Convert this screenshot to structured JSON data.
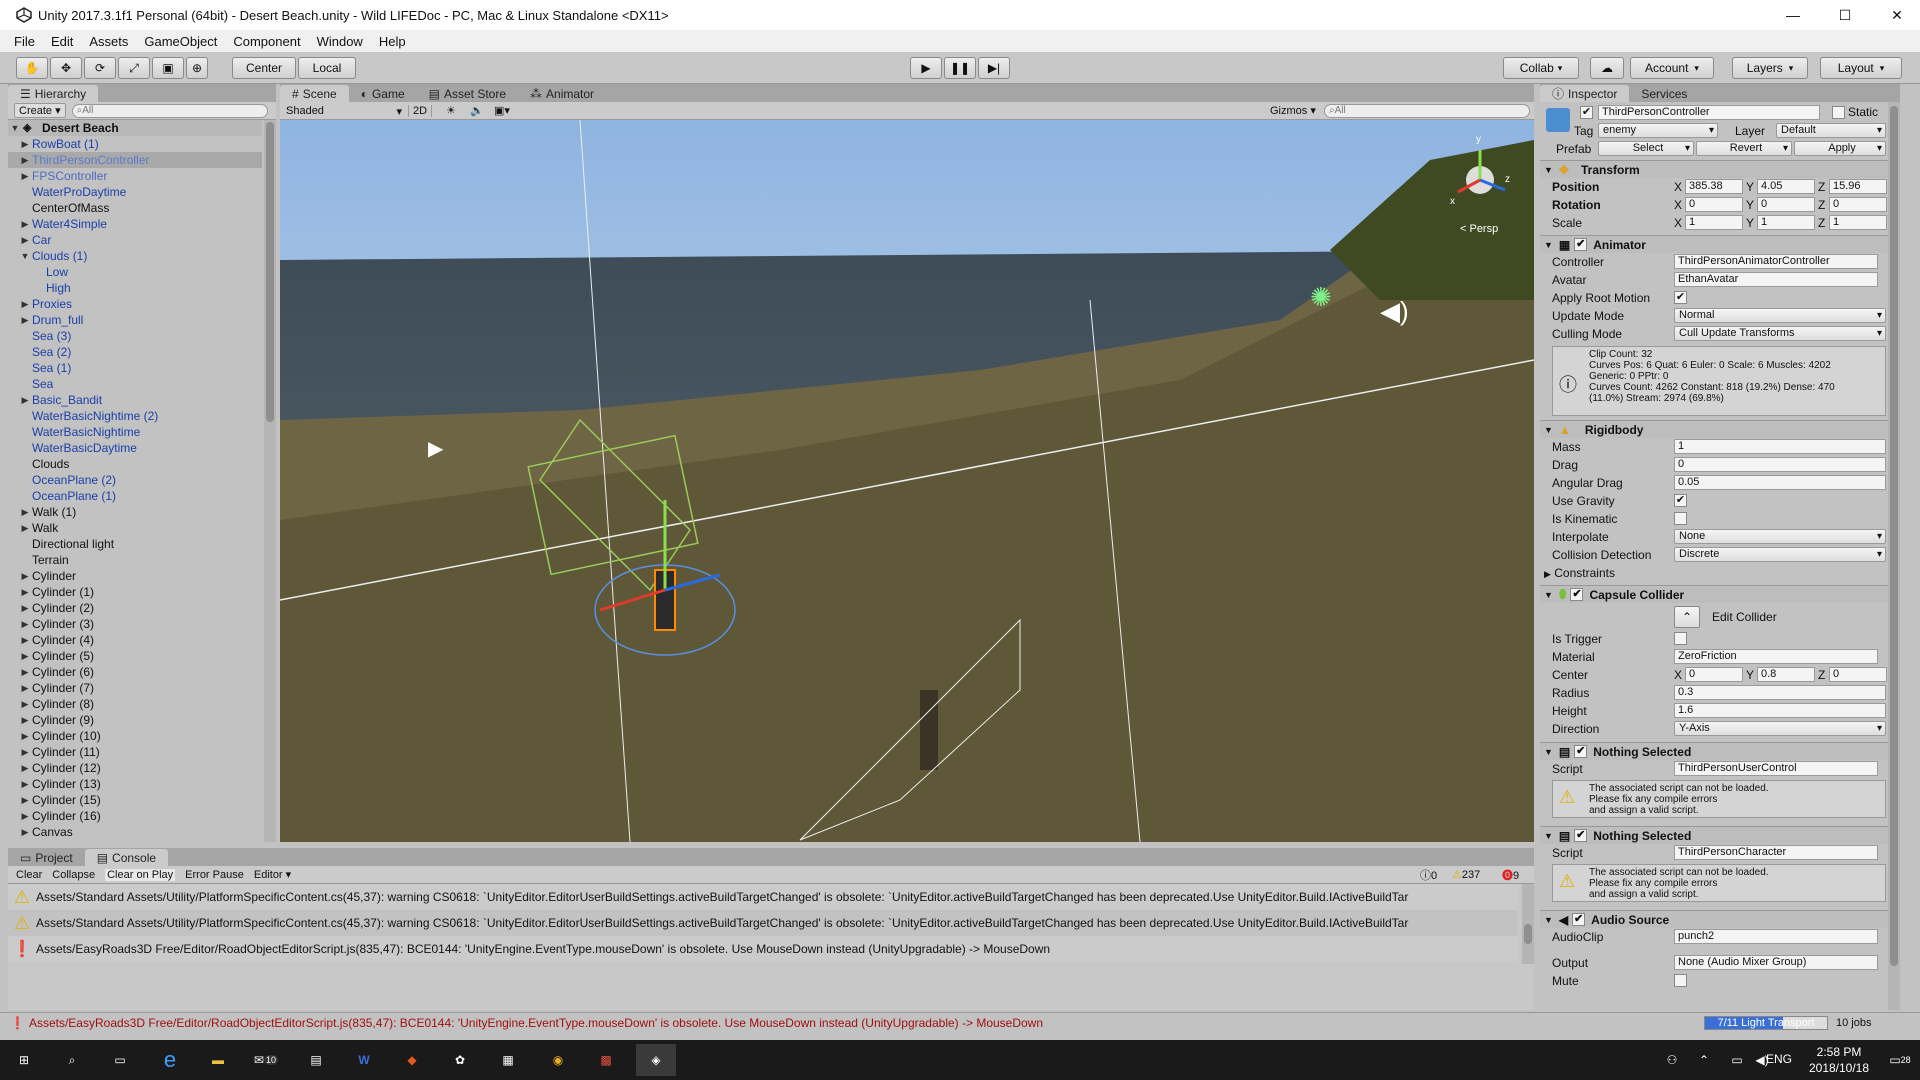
{
  "window": {
    "title": "Unity 2017.3.1f1 Personal (64bit) - Desert Beach.unity - Wild LIFEDoc - PC, Mac & Linux Standalone <DX11>",
    "minimize": "—",
    "maximize": "☐",
    "close": "✕"
  },
  "menu": [
    "File",
    "Edit",
    "Assets",
    "GameObject",
    "Component",
    "Window",
    "Help"
  ],
  "toolbar": {
    "center": "Center",
    "local": "Local",
    "collab": "Collab",
    "account": "Account",
    "layers": "Layers",
    "layout": "Layout"
  },
  "hierarchy": {
    "tab": "Hierarchy",
    "create": "Create",
    "search_placeholder": "All",
    "scene": "Desert Beach",
    "items": [
      {
        "label": "RowBoat (1)",
        "indent": 1,
        "arrow": "right",
        "color": "prefab"
      },
      {
        "label": "ThirdPersonController",
        "indent": 1,
        "arrow": "right",
        "color": "selected"
      },
      {
        "label": "FPSController",
        "indent": 1,
        "arrow": "right",
        "color": "prefab-dim"
      },
      {
        "label": "WaterProDaytime",
        "indent": 1,
        "arrow": "",
        "color": "prefab"
      },
      {
        "label": "CenterOfMass",
        "indent": 1,
        "arrow": "",
        "color": "plain"
      },
      {
        "label": "Water4Simple",
        "indent": 1,
        "arrow": "right",
        "color": "prefab"
      },
      {
        "label": "Car",
        "indent": 1,
        "arrow": "right",
        "color": "prefab"
      },
      {
        "label": "Clouds (1)",
        "indent": 1,
        "arrow": "down",
        "color": "prefab"
      },
      {
        "label": "Low",
        "indent": 2,
        "arrow": "",
        "color": "prefab"
      },
      {
        "label": "High",
        "indent": 2,
        "arrow": "",
        "color": "prefab"
      },
      {
        "label": "Proxies",
        "indent": 1,
        "arrow": "right",
        "color": "prefab"
      },
      {
        "label": "Drum_full",
        "indent": 1,
        "arrow": "right",
        "color": "prefab"
      },
      {
        "label": "Sea (3)",
        "indent": 1,
        "arrow": "",
        "color": "prefab"
      },
      {
        "label": "Sea (2)",
        "indent": 1,
        "arrow": "",
        "color": "prefab"
      },
      {
        "label": "Sea (1)",
        "indent": 1,
        "arrow": "",
        "color": "prefab"
      },
      {
        "label": "Sea",
        "indent": 1,
        "arrow": "",
        "color": "prefab"
      },
      {
        "label": "Basic_Bandit",
        "indent": 1,
        "arrow": "right",
        "color": "prefab"
      },
      {
        "label": "WaterBasicNightime (2)",
        "indent": 1,
        "arrow": "",
        "color": "prefab"
      },
      {
        "label": "WaterBasicNightime",
        "indent": 1,
        "arrow": "",
        "color": "prefab"
      },
      {
        "label": "WaterBasicDaytime",
        "indent": 1,
        "arrow": "",
        "color": "prefab"
      },
      {
        "label": "Clouds",
        "indent": 1,
        "arrow": "",
        "color": "plain"
      },
      {
        "label": "OceanPlane (2)",
        "indent": 1,
        "arrow": "",
        "color": "prefab"
      },
      {
        "label": "OceanPlane (1)",
        "indent": 1,
        "arrow": "",
        "color": "prefab"
      },
      {
        "label": "Walk (1)",
        "indent": 1,
        "arrow": "right",
        "color": "plain"
      },
      {
        "label": "Walk",
        "indent": 1,
        "arrow": "right",
        "color": "plain"
      },
      {
        "label": "Directional light",
        "indent": 1,
        "arrow": "",
        "color": "plain"
      },
      {
        "label": "Terrain",
        "indent": 1,
        "arrow": "",
        "color": "plain"
      },
      {
        "label": "Cylinder",
        "indent": 1,
        "arrow": "right",
        "color": "plain"
      },
      {
        "label": "Cylinder (1)",
        "indent": 1,
        "arrow": "right",
        "color": "plain"
      },
      {
        "label": "Cylinder (2)",
        "indent": 1,
        "arrow": "right",
        "color": "plain"
      },
      {
        "label": "Cylinder (3)",
        "indent": 1,
        "arrow": "right",
        "color": "plain"
      },
      {
        "label": "Cylinder (4)",
        "indent": 1,
        "arrow": "right",
        "color": "plain"
      },
      {
        "label": "Cylinder (5)",
        "indent": 1,
        "arrow": "right",
        "color": "plain"
      },
      {
        "label": "Cylinder (6)",
        "indent": 1,
        "arrow": "right",
        "color": "plain"
      },
      {
        "label": "Cylinder (7)",
        "indent": 1,
        "arrow": "right",
        "color": "plain"
      },
      {
        "label": "Cylinder (8)",
        "indent": 1,
        "arrow": "right",
        "color": "plain"
      },
      {
        "label": "Cylinder (9)",
        "indent": 1,
        "arrow": "right",
        "color": "plain"
      },
      {
        "label": "Cylinder (10)",
        "indent": 1,
        "arrow": "right",
        "color": "plain"
      },
      {
        "label": "Cylinder (11)",
        "indent": 1,
        "arrow": "right",
        "color": "plain"
      },
      {
        "label": "Cylinder (12)",
        "indent": 1,
        "arrow": "right",
        "color": "plain"
      },
      {
        "label": "Cylinder (13)",
        "indent": 1,
        "arrow": "right",
        "color": "plain"
      },
      {
        "label": "Cylinder (15)",
        "indent": 1,
        "arrow": "right",
        "color": "plain"
      },
      {
        "label": "Cylinder (16)",
        "indent": 1,
        "arrow": "right",
        "color": "plain"
      },
      {
        "label": "Canvas",
        "indent": 1,
        "arrow": "right",
        "color": "plain"
      }
    ]
  },
  "scene": {
    "tabs": [
      "Scene",
      "Game",
      "Asset Store",
      "Animator"
    ],
    "shading": "Shaded",
    "mode2d": "2D",
    "gizmos": "Gizmos",
    "search_placeholder": "All",
    "persp": "< Persp"
  },
  "console": {
    "tabs": [
      "Project",
      "Console"
    ],
    "buttons": [
      "Clear",
      "Collapse",
      "Clear on Play",
      "Error Pause",
      "Editor"
    ],
    "counts": {
      "info": "0",
      "warn": "237",
      "error": "9"
    },
    "rows": [
      {
        "type": "warning",
        "text": "Assets/Standard Assets/Utility/PlatformSpecificContent.cs(45,37): warning CS0618: `UnityEditor.EditorUserBuildSettings.activeBuildTargetChanged' is obsolete: `UnityEditor.activeBuildTargetChanged has been deprecated.Use UnityEditor.Build.IActiveBuildTar"
      },
      {
        "type": "warning",
        "text": "Assets/Standard Assets/Utility/PlatformSpecificContent.cs(45,37): warning CS0618: `UnityEditor.EditorUserBuildSettings.activeBuildTargetChanged' is obsolete: `UnityEditor.activeBuildTargetChanged has been deprecated.Use UnityEditor.Build.IActiveBuildTar"
      },
      {
        "type": "error",
        "text": "Assets/EasyRoads3D Free/Editor/RoadObjectEditorScript.js(835,47): BCE0144: 'UnityEngine.EventType.mouseDown' is obsolete. Use MouseDown instead (UnityUpgradable) -> MouseDown"
      }
    ]
  },
  "statusbar": {
    "text": "Assets/EasyRoads3D Free/Editor/RoadObjectEditorScript.js(835,47): BCE0144: 'UnityEngine.EventType.mouseDown' is obsolete. Use MouseDown instead (UnityUpgradable) -> MouseDown",
    "progress": "7/11 Light Transport",
    "jobs": "10 jobs",
    "progress_fraction": 0.64
  },
  "inspector": {
    "tabs": [
      "Inspector",
      "Services"
    ],
    "object_name": "ThirdPersonController",
    "static": "Static",
    "tag_label": "Tag",
    "tag": "enemy",
    "layer_label": "Layer",
    "layer": "Default",
    "prefab_label": "Prefab",
    "prefab_buttons": [
      "Select",
      "Revert",
      "Apply"
    ],
    "transform": {
      "title": "Transform",
      "position_label": "Position",
      "rotation_label": "Rotation",
      "scale_label": "Scale",
      "position": [
        "385.38",
        "4.05",
        "15.96"
      ],
      "rotation": [
        "0",
        "0",
        "0"
      ],
      "scale": [
        "1",
        "1",
        "1"
      ]
    },
    "animator": {
      "title": "Animator",
      "controller_label": "Controller",
      "controller": "ThirdPersonAnimatorController",
      "avatar_label": "Avatar",
      "avatar": "EthanAvatar",
      "root_motion_label": "Apply Root Motion",
      "update_label": "Update Mode",
      "update": "Normal",
      "culling_label": "Culling Mode",
      "culling": "Cull Update Transforms",
      "info": [
        "Clip Count: 32",
        "Curves Pos: 6 Quat: 6 Euler: 0 Scale: 6 Muscles: 4202",
        "Generic: 0 PPtr: 0",
        "Curves Count: 4262 Constant: 818 (19.2%) Dense: 470",
        "(11.0%) Stream: 2974 (69.8%)"
      ]
    },
    "rigidbody": {
      "title": "Rigidbody",
      "mass_label": "Mass",
      "mass": "1",
      "drag_label": "Drag",
      "drag": "0",
      "angular_label": "Angular Drag",
      "angular": "0.05",
      "gravity_label": "Use Gravity",
      "kinematic_label": "Is Kinematic",
      "interpolate_label": "Interpolate",
      "interpolate": "None",
      "collision_label": "Collision Detection",
      "collision": "Discrete",
      "constraints_label": "Constraints"
    },
    "capsule": {
      "title": "Capsule Collider",
      "edit": "Edit Collider",
      "trigger_label": "Is Trigger",
      "material_label": "Material",
      "material": "ZeroFriction",
      "center_label": "Center",
      "center": [
        "0",
        "0.8",
        "0"
      ],
      "radius_label": "Radius",
      "radius": "0.3",
      "height_label": "Height",
      "height": "1.6",
      "direction_label": "Direction",
      "direction": "Y-Axis"
    },
    "script1": {
      "title": "Nothing Selected",
      "script_label": "Script",
      "script": "ThirdPersonUserControl",
      "warn": [
        "The associated script can not be loaded.",
        "Please fix any compile errors",
        "and assign a valid script."
      ]
    },
    "script2": {
      "title": "Nothing Selected",
      "script_label": "Script",
      "script": "ThirdPersonCharacter",
      "warn": [
        "The associated script can not be loaded.",
        "Please fix any compile errors",
        "and assign a valid script."
      ]
    },
    "audio": {
      "title": "Audio Source",
      "clip_label": "AudioClip",
      "clip": "punch2",
      "output_label": "Output",
      "output": "None (Audio Mixer Group)",
      "mute_label": "Mute"
    }
  },
  "taskbar": {
    "time": "2:58 PM",
    "date": "2018/10/18",
    "lang": "ENG",
    "mail_badge": "10",
    "notif": "28"
  }
}
